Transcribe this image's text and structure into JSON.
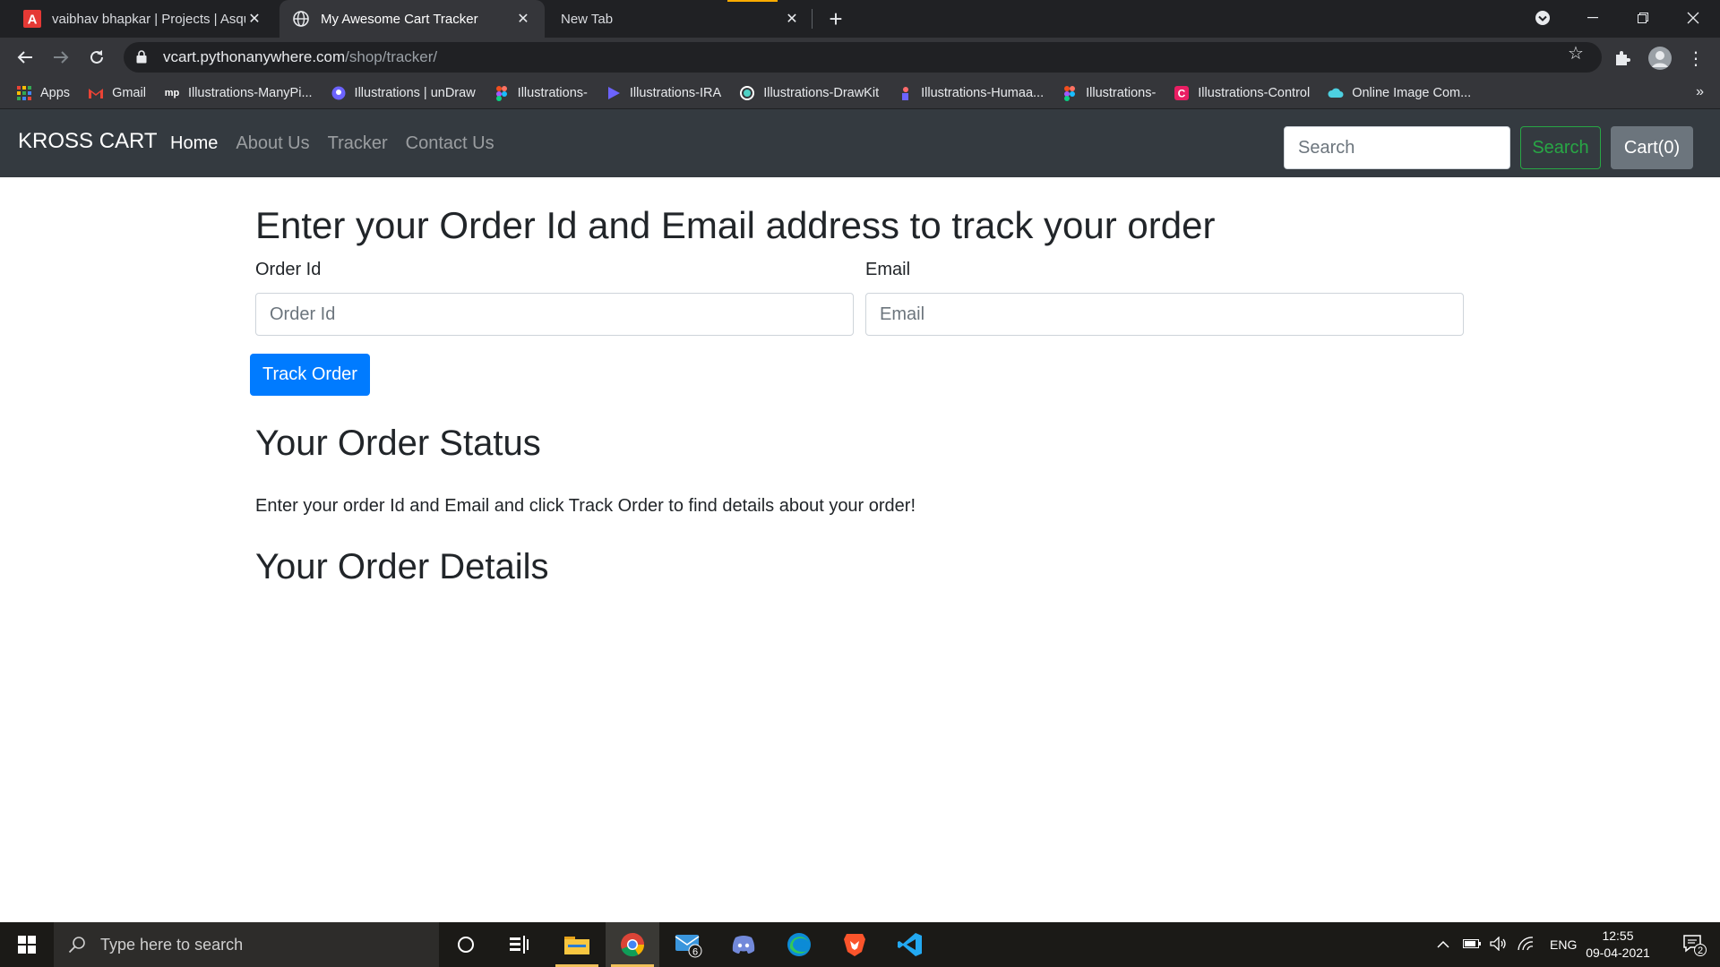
{
  "browser": {
    "tabs": [
      {
        "title": "vaibhav bhapkar | Projects | Asqu",
        "active": false
      },
      {
        "title": "My Awesome Cart Tracker",
        "active": true
      },
      {
        "title": "New Tab",
        "active": false
      }
    ],
    "url_host": "vcart.pythonanywhere.com",
    "url_path": "/shop/tracker/",
    "bookmarks": [
      {
        "label": "Apps",
        "icon": "apps-grid-icon",
        "color": "#ea4335"
      },
      {
        "label": "Gmail",
        "icon": "gmail-icon",
        "color": "#ea4335"
      },
      {
        "label": "Illustrations-ManyPi...",
        "icon": "manypixels-icon",
        "color": "#ffffff"
      },
      {
        "label": "Illustrations | unDraw",
        "icon": "undraw-icon",
        "color": "#6c63ff"
      },
      {
        "label": "Illustrations-",
        "icon": "figma-icon",
        "color": "#a259ff"
      },
      {
        "label": "Illustrations-IRA",
        "icon": "ira-icon",
        "color": "#6c63ff"
      },
      {
        "label": "Illustrations-DrawKit",
        "icon": "drawkit-icon",
        "color": "#4fd1c5"
      },
      {
        "label": "Illustrations-Humaa...",
        "icon": "humaaans-icon",
        "color": "#ff6b6b"
      },
      {
        "label": "Illustrations-",
        "icon": "figma-icon",
        "color": "#a259ff"
      },
      {
        "label": "Illustrations-Control",
        "icon": "control-icon",
        "color": "#e91e63"
      },
      {
        "label": "Online Image Com...",
        "icon": "cloud-icon",
        "color": "#4dd0e1"
      }
    ],
    "bookmarks_more": "»"
  },
  "site": {
    "brand": "KROSS CART",
    "nav": [
      {
        "label": "Home",
        "active": true
      },
      {
        "label": "About Us",
        "active": false
      },
      {
        "label": "Tracker",
        "active": false
      },
      {
        "label": "Contact Us",
        "active": false
      }
    ],
    "search_placeholder": "Search",
    "search_button": "Search",
    "cart_button": "Cart(0)"
  },
  "page": {
    "heading": "Enter your Order Id and Email address to track your order",
    "order_id_label": "Order Id",
    "order_id_placeholder": "Order Id",
    "email_label": "Email",
    "email_placeholder": "Email",
    "track_button": "Track Order",
    "status_heading": "Your Order Status",
    "status_text": "Enter your order Id and Email and click Track Order to find details about your order!",
    "details_heading": "Your Order Details"
  },
  "taskbar": {
    "search_placeholder": "Type here to search",
    "mail_badge": "6",
    "language": "ENG",
    "time": "12:55",
    "date": "09-04-2021",
    "notification_count": "2"
  },
  "colors": {
    "navbar_bg": "#343a40",
    "primary": "#007bff",
    "success": "#28a745",
    "secondary": "#6c757d"
  }
}
